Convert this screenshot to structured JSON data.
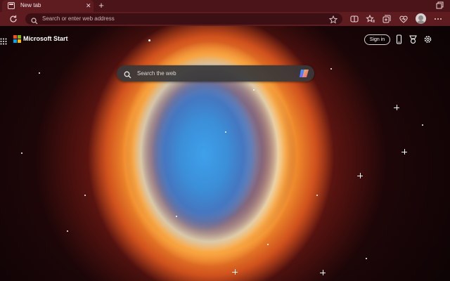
{
  "browser": {
    "tab": {
      "title": "New tab",
      "close_glyph": "✕",
      "icon": "newtab-page-icon"
    },
    "new_tab_glyph": "+",
    "address_bar": {
      "placeholder": "Search or enter web address"
    },
    "toolbar_icons": [
      "refresh-icon",
      "split-screen-icon",
      "favorites-icon",
      "collections-icon",
      "browser-essentials-icon",
      "profile-avatar",
      "more-icon"
    ]
  },
  "page": {
    "brand": "Microsoft Start",
    "sign_in_label": "Sign in",
    "search": {
      "placeholder": "Search the web"
    },
    "header_icons": [
      "phone-icon",
      "rewards-icon",
      "settings-icon"
    ]
  },
  "colors": {
    "tabstrip": "#4a1419",
    "toolbar": "#5e1c21",
    "addressbar": "#3b0f13",
    "ms_logo": [
      "#f25022",
      "#7fba00",
      "#00a4ef",
      "#ffb900"
    ]
  }
}
